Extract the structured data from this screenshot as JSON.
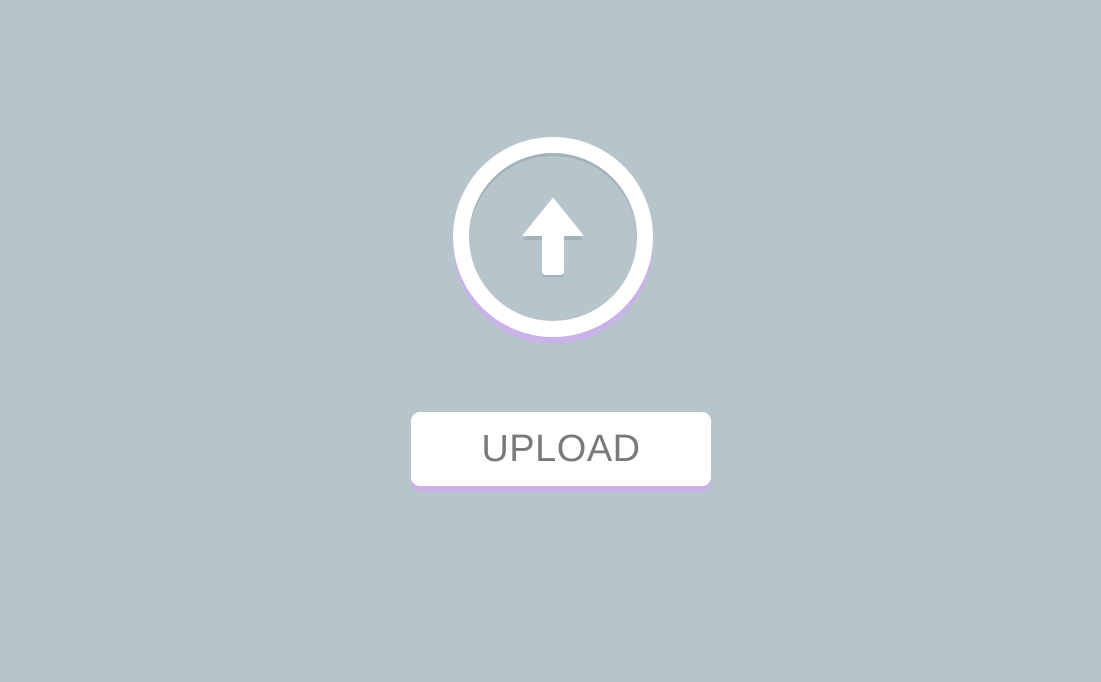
{
  "upload_circle": {
    "icon": "arrow-up-icon"
  },
  "upload_button": {
    "label": "UPLOAD"
  },
  "colors": {
    "background": "#b6c5cc",
    "surface": "#ffffff",
    "accent_shadow": "#c9b3e6",
    "label_text": "#7a7a7a"
  }
}
